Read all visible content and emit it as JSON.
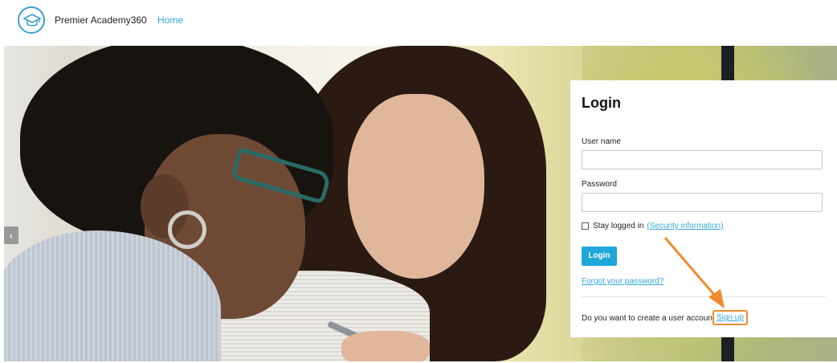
{
  "header": {
    "brand": "Premier Academy360",
    "nav_home": "Home",
    "logo_icon": "graduation-cap-icon",
    "accent": "#35a7d6"
  },
  "hero": {
    "prev_arrow": "‹"
  },
  "login": {
    "title": "Login",
    "username_label": "User name",
    "username_value": "",
    "password_label": "Password",
    "password_value": "",
    "stay_logged_in": "Stay logged in",
    "security_info": "(Security information)",
    "login_button": "Login",
    "forgot_password": "Forgot your password?",
    "create_account_prompt": "Do you want to create a user account?",
    "signup": "Sign up"
  },
  "colors": {
    "button": "#1ea7d8",
    "highlight_arrow": "#f08a2b"
  }
}
